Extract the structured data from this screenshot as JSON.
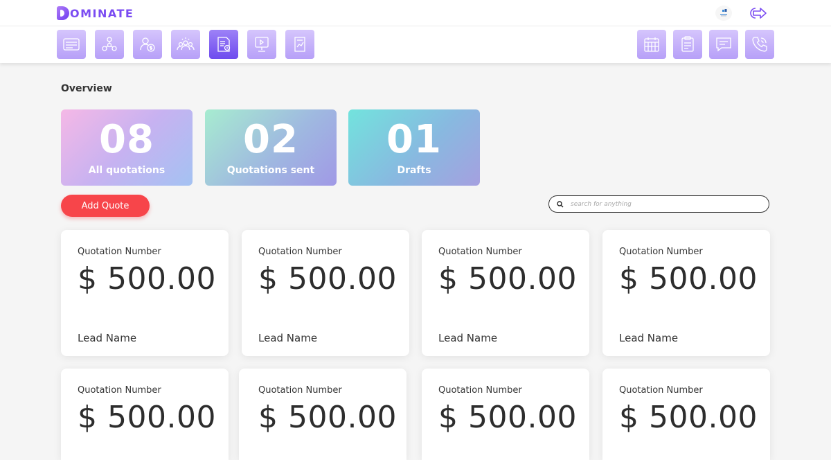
{
  "app": {
    "logo_text": "OMINATE",
    "brand_colors": {
      "accent": "#7b4cf2",
      "nav_tile": "#c6b4fa",
      "nav_active": "#7a58f0",
      "danger": "#f7454a"
    }
  },
  "header": {
    "brand_mark_icon": "company-logo-icon",
    "logout_icon": "logout-arrow-icon"
  },
  "nav": {
    "left_items": [
      {
        "icon": "dashboard-list-icon",
        "active": false
      },
      {
        "icon": "network-nodes-icon",
        "active": false
      },
      {
        "icon": "user-money-icon",
        "active": false
      },
      {
        "icon": "team-group-icon",
        "active": false
      },
      {
        "icon": "quotation-document-icon",
        "active": true
      },
      {
        "icon": "presentation-board-icon",
        "active": false
      },
      {
        "icon": "report-chart-icon",
        "active": false
      }
    ],
    "right_items": [
      {
        "icon": "calendar-icon"
      },
      {
        "icon": "clipboard-icon"
      },
      {
        "icon": "chat-message-icon"
      },
      {
        "icon": "phone-call-icon"
      }
    ]
  },
  "overview": {
    "title": "Overview",
    "stats": [
      {
        "value": "08",
        "label": "All quotations"
      },
      {
        "value": "02",
        "label": "Quotations sent"
      },
      {
        "value": "01",
        "label": "Drafts"
      }
    ]
  },
  "actions": {
    "add_quote_label": "Add Quote",
    "search_placeholder": "search for anything",
    "search_icon": "search-icon"
  },
  "quotes": [
    {
      "title": "Quotation Number",
      "amount": "$ 500.00",
      "lead": "Lead Name"
    },
    {
      "title": "Quotation Number",
      "amount": "$ 500.00",
      "lead": "Lead Name"
    },
    {
      "title": "Quotation Number",
      "amount": "$ 500.00",
      "lead": "Lead Name"
    },
    {
      "title": "Quotation Number",
      "amount": "$ 500.00",
      "lead": "Lead Name"
    },
    {
      "title": "Quotation Number",
      "amount": "$ 500.00",
      "lead": ""
    },
    {
      "title": "Quotation Number",
      "amount": "$ 500.00",
      "lead": ""
    },
    {
      "title": "Quotation Number",
      "amount": "$ 500.00",
      "lead": ""
    },
    {
      "title": "Quotation Number",
      "amount": "$ 500.00",
      "lead": ""
    }
  ]
}
